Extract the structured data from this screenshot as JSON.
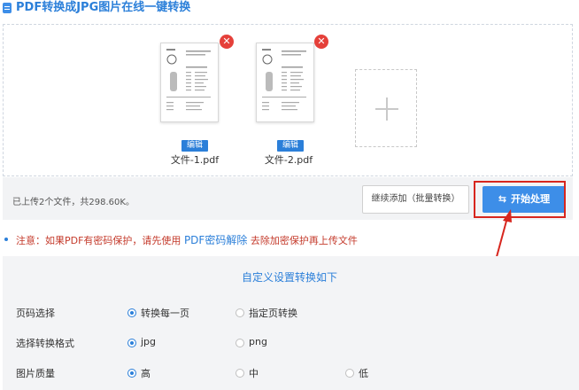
{
  "header": {
    "title": "PDF转换成JPG图片在线一键转换",
    "icon": "document-icon"
  },
  "files": [
    {
      "name": "文件-1.pdf",
      "edit_label": "编辑",
      "delete_icon": "close-icon"
    },
    {
      "name": "文件-2.pdf",
      "edit_label": "编辑",
      "delete_icon": "close-icon"
    }
  ],
  "add_file": {
    "icon": "plus-icon"
  },
  "status": {
    "summary": "已上传2个文件，共298.60K。",
    "continue_label": "继续添加（批量转换）",
    "start_label": "开始处理",
    "start_icon": "swap-arrows-icon"
  },
  "notice": {
    "prefix": "注意：如果PDF有密码保护，请先使用",
    "link": "PDF密码解除",
    "suffix": "去除加密保护再上传文件"
  },
  "settings": {
    "title": "自定义设置转换如下",
    "rows": [
      {
        "label": "页码选择",
        "options": [
          "转换每一页",
          "指定页转换"
        ],
        "selected": 0
      },
      {
        "label": "选择转换格式",
        "options": [
          "jpg",
          "png"
        ],
        "selected": 0
      },
      {
        "label": "图片质量",
        "options": [
          "高",
          "中",
          "低"
        ],
        "selected": 0
      }
    ]
  },
  "colors": {
    "accent": "#3d8ee8",
    "highlight": "#d7261e",
    "delete": "#e5403a"
  }
}
